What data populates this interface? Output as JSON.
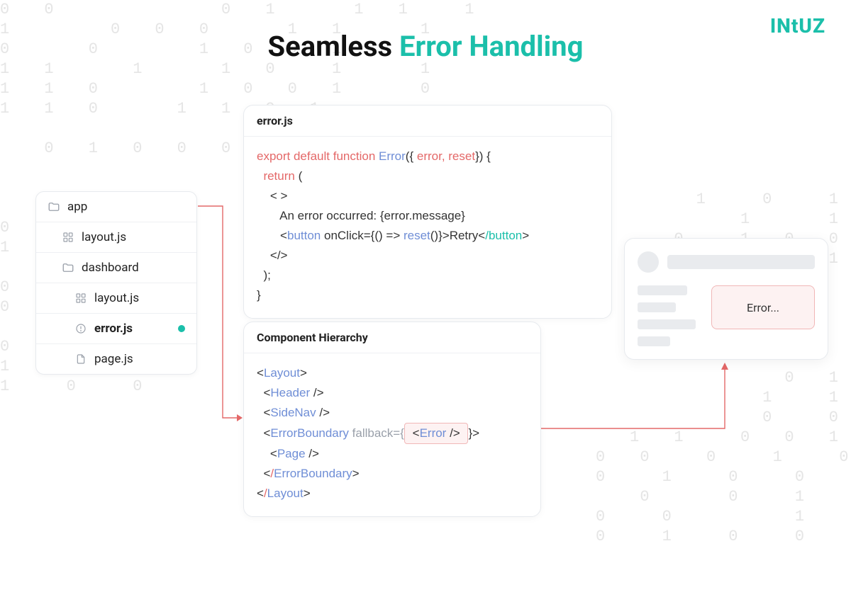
{
  "brand": "INtUZ",
  "heading": {
    "plain": "Seamless ",
    "accent": "Error Handling"
  },
  "filetree": {
    "items": [
      {
        "icon": "folder",
        "label": "app",
        "depth": 0
      },
      {
        "icon": "grid",
        "label": "layout.js",
        "depth": 1
      },
      {
        "icon": "folder",
        "label": "dashboard",
        "depth": 1
      },
      {
        "icon": "grid",
        "label": "layout.js",
        "depth": 2
      },
      {
        "icon": "alert",
        "label": "error.js",
        "depth": 2,
        "active": true
      },
      {
        "icon": "file",
        "label": "page.js",
        "depth": 2
      }
    ]
  },
  "errorjs": {
    "title": "error.js",
    "line1_export": "export default ",
    "line1_function": "function ",
    "line1_name": "Error",
    "line1_open": "({ ",
    "line1_params": "error, reset",
    "line1_close": "}) {",
    "line2_return": "  return ",
    "line2_paren": "(",
    "line3": "    < >",
    "line4": "       An error occurred: {error.message}",
    "line5_a": "       <",
    "line5_button": "button",
    "line5_b": " onClick={",
    "line5_arrow": "() => ",
    "line5_reset": "reset",
    "line5_c": "()}",
    "line5_d": ">Retry<",
    "line5_e": "/button",
    "line5_f": ">",
    "line6": "    </>",
    "line7": "  );",
    "line8": "}"
  },
  "hierarchy": {
    "title": "Component Hierarchy",
    "l1_a": "<",
    "l1_tag": "Layout",
    "l1_b": ">",
    "l2_a": "  <",
    "l2_tag": "Header ",
    "l2_b": "/>",
    "l3_a": "  <",
    "l3_tag": "SideNav ",
    "l3_b": "/>",
    "l4_a": "  <",
    "l4_tag": "ErrorBoundary ",
    "l4_fallback": "fallback={",
    "l4_box_a": " <",
    "l4_box_tag": "Error ",
    "l4_box_b": "/> ",
    "l4_c": "}>",
    "l5_a": "    <",
    "l5_tag": "Page ",
    "l5_b": "/>",
    "l6_a": "  <",
    "l6_slash": "/",
    "l6_tag": "ErrorBoundary",
    "l6_b": ">",
    "l7_a": "<",
    "l7_slash": "/",
    "l7_tag": "Layout",
    "l7_b": ">"
  },
  "uimock": {
    "errorLabel": "Error..."
  },
  "bg": {
    "left": "0 0       0 1   1 1  1\n1    0 0 0   1 1   1\n0   0    1 0 0 1 1\n1 1   1   1 0  1   1\n1 1 0    1 0 0 1   0\n1 1 0   1 1 0 1\n            1   0 0 1\n  0 1 0 0 0 1 1   0 1\n\n\n\n0\n1\n\n0\n0\n\n0\n1\n1  0  0\n",
    "right": "\n\n\n\n\n\n1  0  1\n 1   1\n0  1 0 0\n  0  1\n\n\n\n\n\n0 1\n 1  1\n 0  0\n1 1  0 0 1\n0 0  0  1  0\n0  1  0  0  0  1\n  0   0  1  1  1\n0  0     1  1  0\n0  1  0  0  0  1  1"
  }
}
